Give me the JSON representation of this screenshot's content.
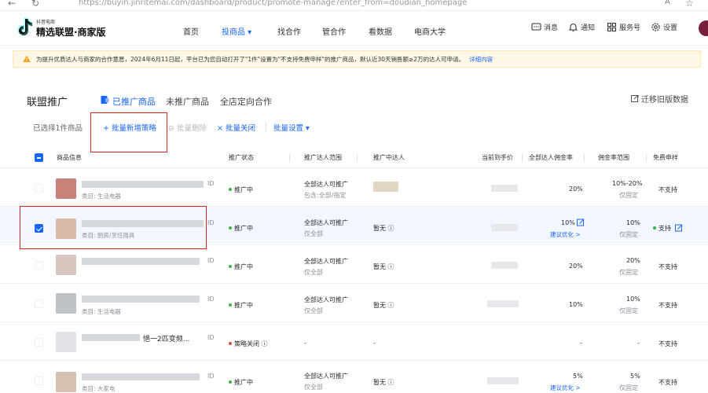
{
  "browser": {
    "back": "←",
    "reload": "↻",
    "url": "https://buyin.jinritemai.com/dashboard/product/promote-manage?enter_from=doudian_homepage",
    "ext1": "A",
    "ext2": "☆"
  },
  "header": {
    "brand_small": "抖音电商",
    "brand": "精选联盟·商家版",
    "nav": [
      "首页",
      "投商品 ▾",
      "找合作",
      "管合作",
      "看数据",
      "电商大学"
    ],
    "active_nav": 1,
    "tools": {
      "message": "消息",
      "notify": "通知",
      "service": "服务号",
      "settings": "设置"
    }
  },
  "notice": {
    "text": "为提升优质达人与商家的合作意愿，2024年6月11日起，平台已为您自动打开了\"1件\"设置为\"不支持免费申样\"的推广商品，默认近30天销售额≥2万的达人可申请。",
    "link": "详细内容"
  },
  "page": {
    "title": "联盟推广",
    "tabs": [
      "已推广商品",
      "未推广商品",
      "全店定向合作"
    ],
    "active_tab": 0,
    "migrate": "迁移旧版数据"
  },
  "batch": {
    "selected": "已选择1件商品",
    "add_strategy": "+ 批量新增策略",
    "delete": "⊖ 批量删除",
    "close": "× 批量关闭",
    "settings": "批量设置 ▾"
  },
  "table": {
    "headers": [
      "商品信息",
      "推广状态",
      "推广达人范围",
      "推广中达人",
      "当前到手价",
      "全部达人佣金率",
      "佣金率范围",
      "免费申样"
    ],
    "rows": [
      {
        "id": "ID",
        "category": "类目: 生活电器",
        "status": "推广中",
        "scope": "全部达人可推广",
        "scope_sub": "包含:全部/指定",
        "influencer": "",
        "commission": "20%",
        "commission_sub": "",
        "range": "10%-20%",
        "range_sub": "仅固定",
        "sample": "不支持",
        "selected": false
      },
      {
        "id": "ID",
        "category": "类目: 厨房/烹饪用具",
        "status": "推广中",
        "scope": "全部达人可推广",
        "scope_sub": "仅全部",
        "influencer": "暂无 ⓘ",
        "commission": "10%",
        "commission_sub": "建议优化 >",
        "range": "10%",
        "range_sub": "仅固定",
        "sample": "支持",
        "selected": true
      },
      {
        "id": "ID",
        "title_frag": "…",
        "category": "",
        "status": "推广中",
        "scope": "全部达人可推广",
        "scope_sub": "仅全部",
        "influencer": "暂无 ⓘ",
        "commission": "20%",
        "commission_sub": "",
        "range": "20%",
        "range_sub": "仅固定",
        "sample": "不支持",
        "selected": false
      },
      {
        "id": "ID",
        "title_frag": "…",
        "category": "类目: 生活电器",
        "status": "推广中",
        "scope": "全部达人可推广",
        "scope_sub": "仅全部",
        "influencer": "暂无 ⓘ",
        "commission": "10%",
        "commission_sub": "",
        "range": "10%",
        "range_sub": "仅固定",
        "sample": "不支持",
        "selected": false
      },
      {
        "id": "ID",
        "title_frag": "悒一2匹变频...",
        "category": "",
        "status": "策略关闭 ⓘ",
        "scope": "-",
        "scope_sub": "",
        "influencer": "-",
        "commission": "-",
        "commission_sub": "",
        "range": "-",
        "range_sub": "",
        "sample": "不支持",
        "selected": false
      },
      {
        "id": "ID",
        "category": "类目: 大家电",
        "status": "推广中",
        "scope": "全部达人可推广",
        "scope_sub": "仅全部",
        "influencer": "暂无 ⓘ",
        "commission": "5%",
        "commission_sub": "建议优化 >",
        "range": "5%",
        "range_sub": "仅固定",
        "sample": "不支持",
        "selected": false
      }
    ]
  },
  "colors": {
    "accent": "#1966ff",
    "highlight": "#d9221c",
    "success": "#3bb346",
    "danger": "#e5483d"
  }
}
